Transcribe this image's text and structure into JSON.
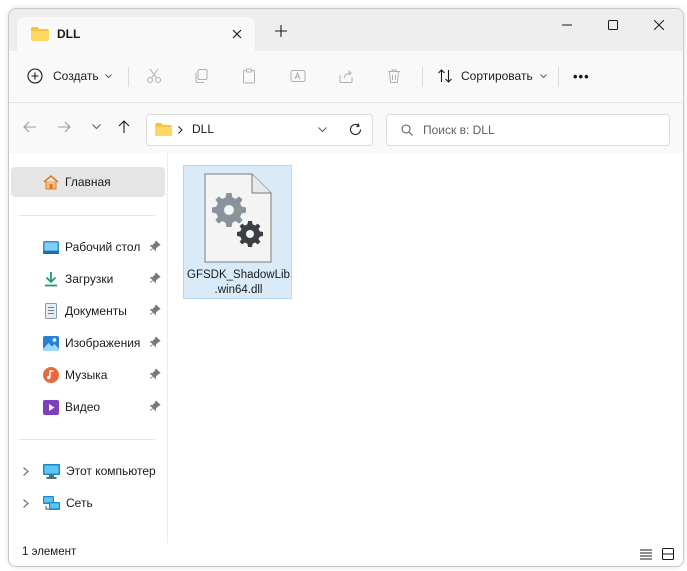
{
  "window": {
    "tab_title": "DLL"
  },
  "toolbar": {
    "create_label": "Создать",
    "sort_label": "Сортировать",
    "more_label": "•••"
  },
  "address": {
    "path": "DLL",
    "search_placeholder": "Поиск в: DLL"
  },
  "sidebar": {
    "home_label": "Главная",
    "quick_access": [
      {
        "label": "Рабочий стол",
        "icon": "desktop-icon"
      },
      {
        "label": "Загрузки",
        "icon": "downloads-icon"
      },
      {
        "label": "Документы",
        "icon": "documents-icon"
      },
      {
        "label": "Изображения",
        "icon": "pictures-icon"
      },
      {
        "label": "Музыка",
        "icon": "music-icon"
      },
      {
        "label": "Видео",
        "icon": "videos-icon"
      }
    ],
    "this_pc_label": "Этот компьютер",
    "network_label": "Сеть"
  },
  "files": [
    {
      "name_line1": "GFSDK_ShadowLib",
      "name_line2": ".win64.dll",
      "icon": "dll-settings-file-icon"
    }
  ],
  "status": {
    "item_count": "1 элемент"
  },
  "colors": {
    "accent": "#0067c0",
    "selection": "#d9ebf9",
    "folder": "#f5c242"
  }
}
